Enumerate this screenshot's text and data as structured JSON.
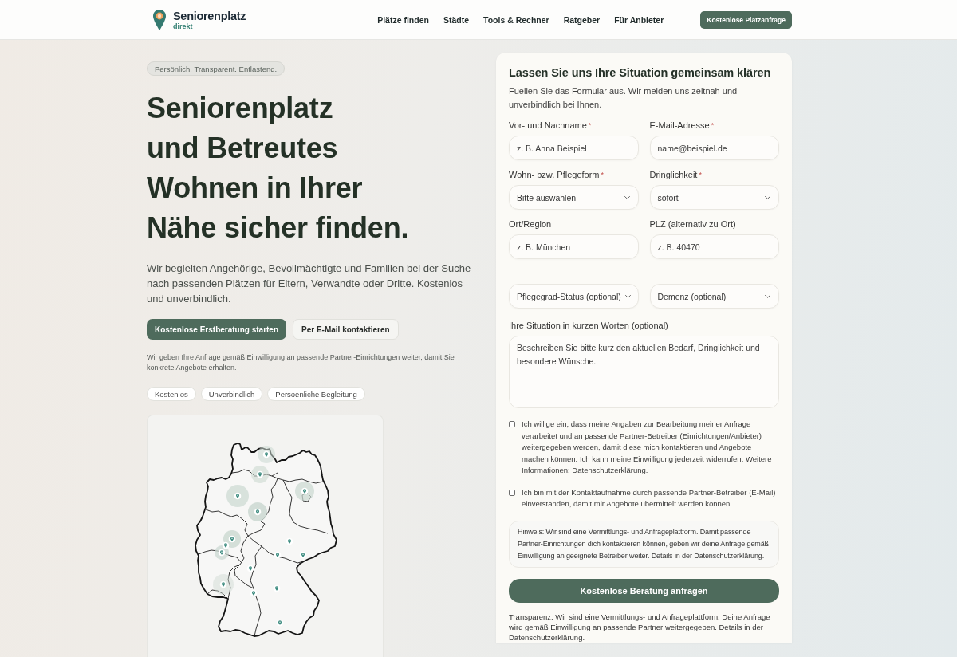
{
  "header": {
    "logo": {
      "name": "Seniorenplatz",
      "suffix": "direkt"
    },
    "nav": [
      "Plätze finden",
      "Städte",
      "Tools & Rechner",
      "Ratgeber",
      "Für Anbieter"
    ],
    "cta": "Kostenlose Platzanfrage"
  },
  "hero": {
    "tagline": "Persönlich. Transparent. Entlastend.",
    "headline_lines": [
      "Seniorenplatz",
      "und Betreutes",
      "Wohnen in Ihrer",
      "Nähe sicher finden."
    ],
    "lead": "Wir begleiten Angehörige, Bevollmächtigte und Familien bei der Suche nach passenden Plätzen für Eltern, Verwandte oder Dritte. Kostenlos und unverbindlich.",
    "buttons": [
      {
        "label": "Kostenlose Erstberatung starten",
        "kind": "primary"
      },
      {
        "label": "Per E-Mail kontaktieren",
        "kind": "secondary"
      }
    ],
    "note": "Wir geben Ihre Anfrage gemäß Einwilligung an passende Partner-Einrichtungen weiter, damit Sie konkrete Angebote erhalten.",
    "chips": [
      "Kostenlos",
      "Unverbindlich",
      "Persoenliche Begleitung"
    ]
  },
  "form": {
    "title": "Lassen Sie uns Ihre Situation gemeinsam klären",
    "intro": "Fuellen Sie das Formular aus. Wir melden uns zeitnah und unverbindlich bei Ihnen.",
    "required_marker": "*",
    "fields": [
      {
        "kind": "text",
        "label": "Vor- und Nachname",
        "required": true,
        "placeholder": "z. B. Anna Beispiel"
      },
      {
        "kind": "text",
        "label": "E-Mail-Adresse",
        "required": true,
        "placeholder": "name@beispiel.de"
      },
      {
        "kind": "select",
        "label": "Wohn- bzw. Pflegeform",
        "required": true,
        "value": "Bitte auswählen"
      },
      {
        "kind": "select",
        "label": "Dringlichkeit",
        "required": true,
        "value": "sofort"
      },
      {
        "kind": "text",
        "label": "Ort/Region",
        "required": false,
        "placeholder": "z. B. München"
      },
      {
        "kind": "text",
        "label": "PLZ (alternativ zu Ort)",
        "required": false,
        "placeholder": "z. B. 40470"
      },
      {
        "kind": "select",
        "value": "Pflegegrad-Status (optional)"
      },
      {
        "kind": "select",
        "value": "Demenz (optional)"
      }
    ],
    "message": {
      "label": "Ihre Situation in kurzen Worten (optional)",
      "placeholder": "Beschreiben Sie bitte kurz den aktuellen Bedarf, Dringlichkeit und besondere Wünsche."
    },
    "consents": [
      {
        "text": "Ich willige ein, dass meine Angaben zur Bearbeitung meiner Anfrage verarbeitet und an passende Partner-Betreiber (Einrichtungen/Anbieter) weitergegeben werden, damit diese mich kontaktieren und Angebote machen können. Ich kann meine Einwilligung jederzeit widerrufen. Weitere Informationen: Datenschutzerklärung.",
        "checked": false
      },
      {
        "text": "Ich bin mit der Kontaktaufnahme durch passende Partner-Betreiber (E-Mail) einverstanden, damit mir Angebote übermittelt werden können.",
        "checked": false
      }
    ],
    "hint": "Hinweis: Wir sind eine Vermittlungs- und Anfrageplattform. Damit passende Partner-Einrichtungen dich kontaktieren können, geben wir deine Anfrage gemäß Einwilligung an geeignete Betreiber weiter. Details in der Datenschutzerklärung.",
    "submit": "Kostenlose Beratung anfragen",
    "transparency": "Transparenz: Wir sind eine Vermittlungs- und Anfrageplattform. Deine Anfrage wird gemäß Einwilligung an passende Partner weitergegeben. Details in der Datenschutzerklärung."
  }
}
